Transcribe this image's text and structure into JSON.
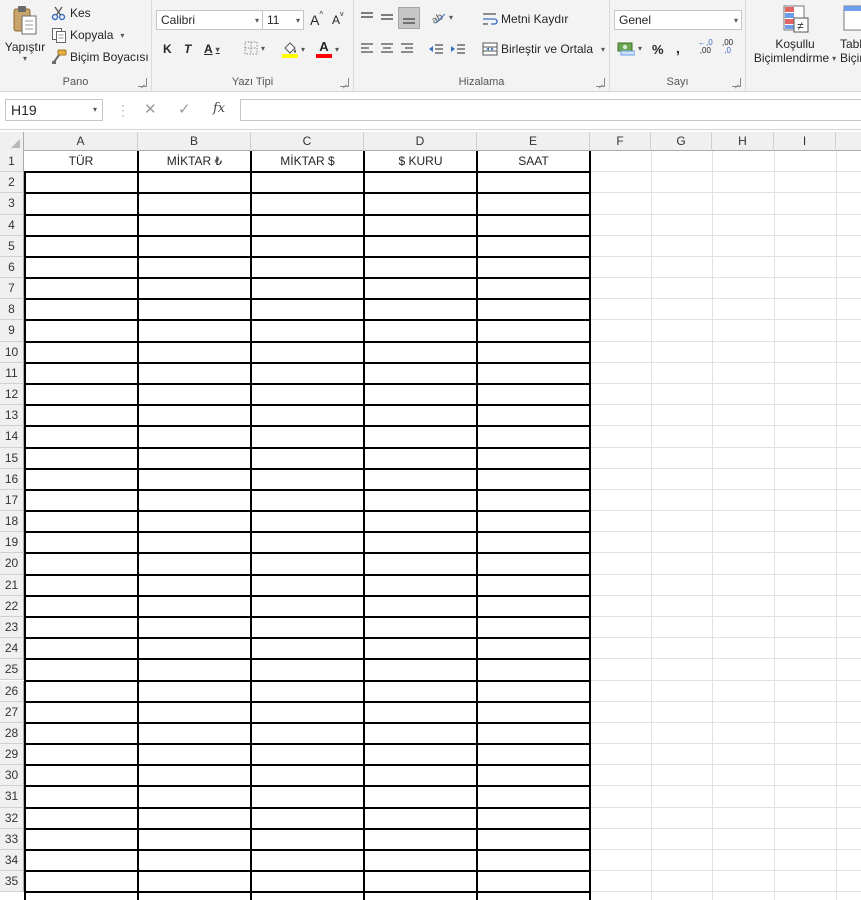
{
  "ribbon": {
    "clipboard": {
      "paste_label": "Yapıştır",
      "cut_label": "Kes",
      "copy_label": "Kopyala",
      "format_painter_label": "Biçim Boyacısı",
      "group_label": "Pano"
    },
    "font": {
      "font_name": "Calibri",
      "font_size": "11",
      "bold_label": "K",
      "italic_label": "T",
      "underline_label": "A",
      "increase_size_label": "A",
      "decrease_size_label": "A",
      "font_color_label": "A",
      "group_label": "Yazı Tipi"
    },
    "alignment": {
      "wrap_text_label": "Metni Kaydır",
      "merge_center_label": "Birleştir ve Ortala",
      "group_label": "Hizalama"
    },
    "number": {
      "format": "Genel",
      "percent_label": "%",
      "comma_label": ",",
      "increase_decimal_label": ",00",
      "decrease_decimal_label": ",0",
      "group_label": "Sayı"
    },
    "styles": {
      "conditional_formatting_label_1": "Koşullu",
      "conditional_formatting_label_2": "Biçimlendirme",
      "table_label_1": "Tabl",
      "table_label_2": "Biçir"
    }
  },
  "formula_bar": {
    "name_box": "H19",
    "fx_label": "fx",
    "formula": ""
  },
  "sheet": {
    "columns": [
      "A",
      "B",
      "C",
      "D",
      "E",
      "F",
      "G",
      "H",
      "I"
    ],
    "header_row": [
      "TÜR",
      "MİKTAR ₺",
      "MİKTAR $",
      "$ KURU",
      "SAAT"
    ],
    "row_numbers": [
      "1",
      "2",
      "3",
      "4",
      "5",
      "6",
      "7",
      "8",
      "9",
      "10",
      "11",
      "12",
      "13",
      "14",
      "15",
      "16",
      "17",
      "18",
      "19",
      "20",
      "21",
      "22",
      "23",
      "24",
      "25",
      "26",
      "27",
      "28",
      "29",
      "30",
      "31",
      "32",
      "33",
      "34",
      "35"
    ]
  },
  "colors": {
    "ribbon_bg": "#f3f3f3",
    "header_bg": "#f0f0f0",
    "border": "#000000",
    "gridline": "#e1e1e1",
    "highlight_yellow": "#ffff00",
    "font_red": "#ff0000"
  },
  "icons": [
    "paste-icon",
    "scissors-icon",
    "copy-icon",
    "format-painter-icon",
    "bold-icon",
    "italic-icon",
    "underline-icon",
    "borders-icon",
    "fill-color-icon",
    "font-color-icon",
    "align-top-icon",
    "align-middle-icon",
    "align-bottom-icon",
    "orientation-icon",
    "align-left-icon",
    "align-center-icon",
    "align-right-icon",
    "decrease-indent-icon",
    "increase-indent-icon",
    "wrap-text-icon",
    "merge-icon",
    "currency-icon",
    "conditional-formatting-icon",
    "cancel-icon",
    "enter-icon",
    "fx-icon"
  ]
}
